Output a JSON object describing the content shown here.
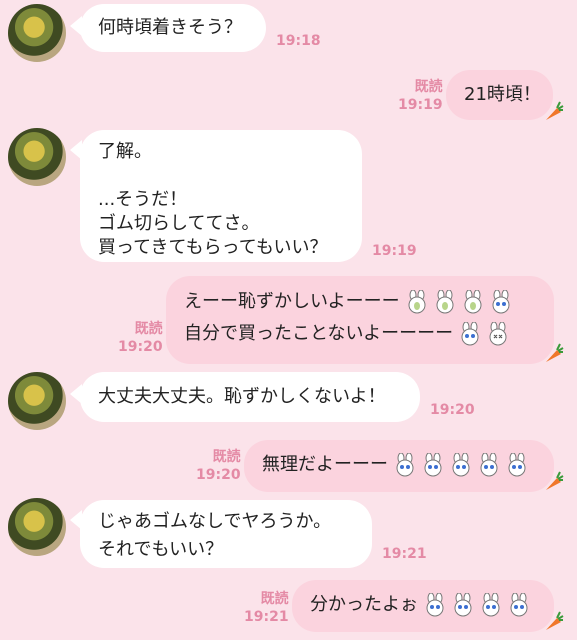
{
  "read_label": "既読",
  "messages": [
    {
      "id": "m1",
      "side": "in",
      "lines": [
        "何時頃着きそう？"
      ],
      "time": "19:18"
    },
    {
      "id": "m2",
      "side": "out",
      "lines": [
        "21時頃！"
      ],
      "time": "19:19",
      "read": true
    },
    {
      "id": "m3",
      "side": "in",
      "lines": [
        "了解。",
        "",
        "...そうだ！",
        "ゴム切らしててさ。",
        "買ってきてもらってもいい？"
      ],
      "time": "19:19"
    },
    {
      "id": "m4",
      "side": "out",
      "lines": [
        "えーー恥ずかしいよーーー",
        "自分で買ったことないよーーーー"
      ],
      "time": "19:20",
      "read": true
    },
    {
      "id": "m5",
      "side": "in",
      "lines": [
        "大丈夫大丈夫。恥ずかしくないよ！"
      ],
      "time": "19:20"
    },
    {
      "id": "m6",
      "side": "out",
      "lines": [
        "無理だよーーー"
      ],
      "time": "19:20",
      "read": true
    },
    {
      "id": "m7",
      "side": "in",
      "lines": [
        "じゃあゴムなしでヤろうか。",
        "それでもいい？"
      ],
      "time": "19:21"
    },
    {
      "id": "m8",
      "side": "out",
      "lines": [
        "分かったよぉ"
      ],
      "time": "19:21",
      "read": true
    }
  ],
  "icons": {
    "carrot": "carrot-icon",
    "bunny": "bunny-emoji-icon"
  },
  "colors": {
    "background": "#fbe3ea",
    "incoming_bubble": "#ffffff",
    "outgoing_bubble": "#fbd3de",
    "time_text": "#e48aa5"
  }
}
